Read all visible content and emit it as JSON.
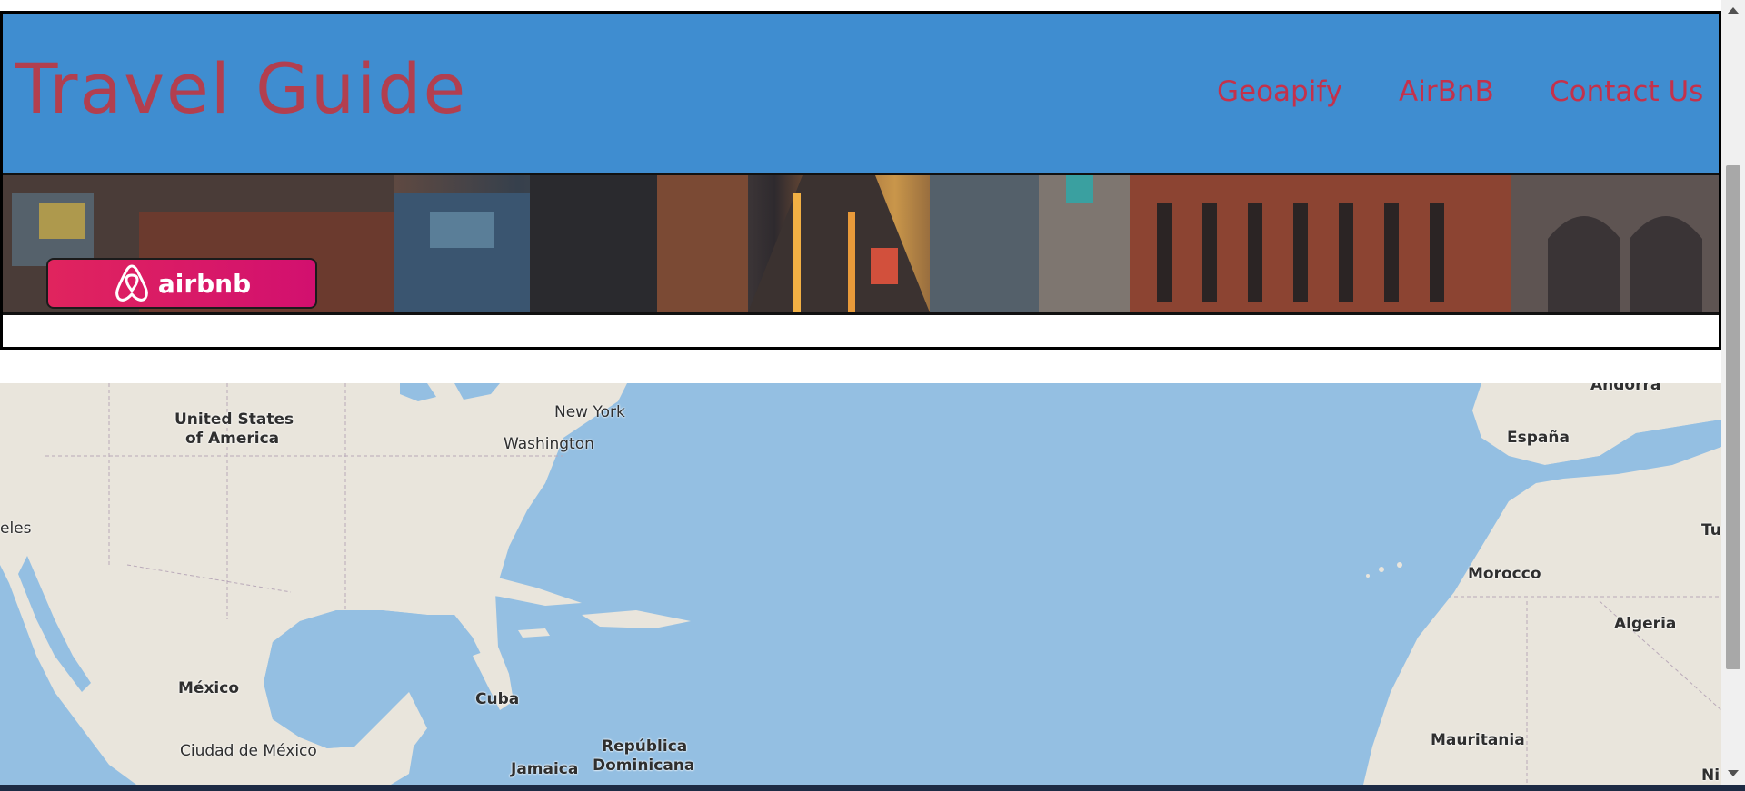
{
  "header": {
    "brand": "Travel Guide",
    "nav": [
      "Geoapify",
      "AirBnB",
      "Contact Us"
    ]
  },
  "banner": {
    "button_label": "airbnb",
    "icon": "airbnb-logo-icon"
  },
  "map": {
    "labels": [
      "United States",
      "of America",
      "New York",
      "Washington",
      "eles",
      "México",
      "Ciudad de México",
      "Cuba",
      "Jamaica",
      "República",
      "Dominicana",
      "Andorra",
      "España",
      "Morocco",
      "Algeria",
      "Tu",
      "Mauritania",
      "Ni"
    ]
  },
  "colors": {
    "navbar": "#3f8dd0",
    "brand_text": "#b23f4f",
    "nav_text": "#c4314b",
    "airbnb": "#e0245e",
    "water": "#94bfe2",
    "land": "#e9e5dc"
  }
}
